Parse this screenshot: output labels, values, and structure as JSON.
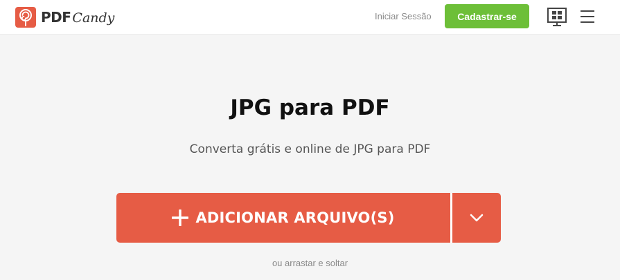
{
  "header": {
    "logo_pdf": "PDF",
    "logo_candy": "Candy",
    "login_label": "Iniciar Sessão",
    "signup_label": "Cadastrar-se",
    "icons": [
      "lollipop-icon",
      "windows-icon",
      "menu-icon"
    ]
  },
  "main": {
    "title": "JPG para PDF",
    "subtitle": "Converta grátis e online de JPG para PDF",
    "upload_label": "ADICIONAR ARQUIVO(S)",
    "drag_hint": "ou arrastar e soltar"
  },
  "colors": {
    "brand": "#e65c45",
    "signup": "#6dbf38",
    "background": "#f5f5f5"
  }
}
